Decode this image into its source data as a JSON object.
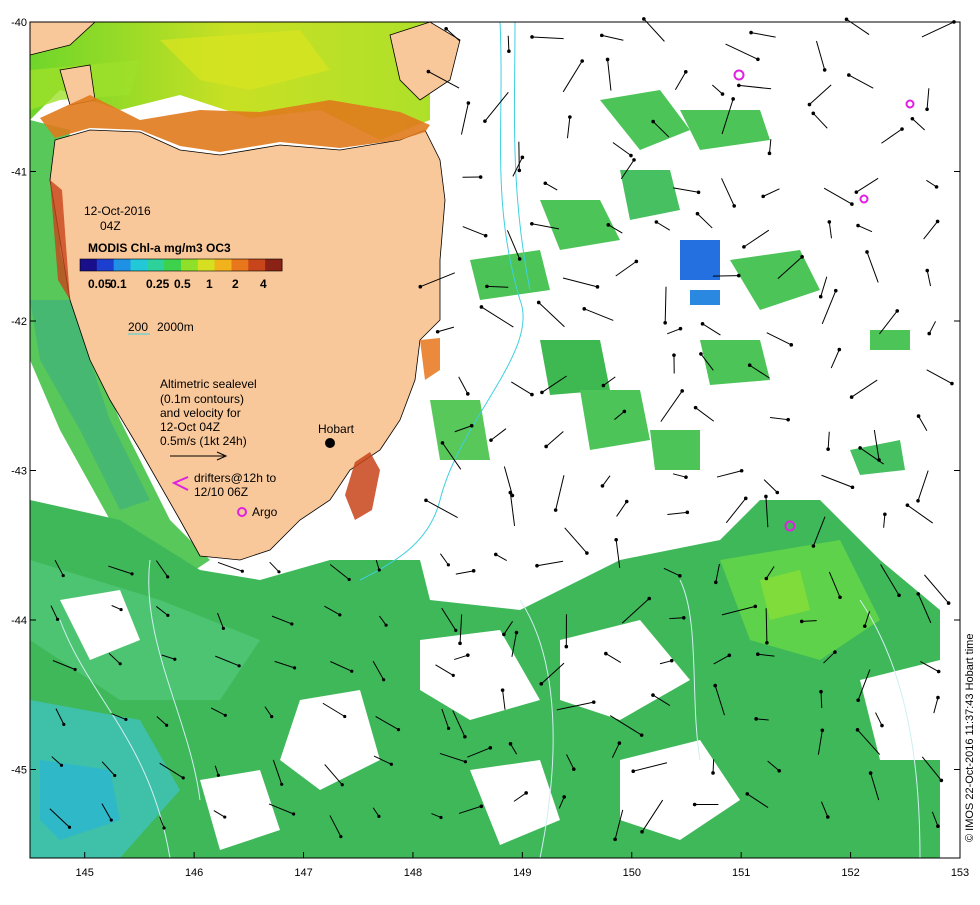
{
  "map": {
    "date_line": "12-Oct-2016",
    "time_line": "04Z",
    "colorbar_title": "MODIS Chl-a mg/m3 OC3",
    "colorbar_ticks": [
      "0.05",
      "0.1",
      "0.25",
      "0.5",
      "1",
      "2",
      "4"
    ],
    "colorbar_colors": [
      "#1a0f8a",
      "#1c3fd0",
      "#1e90e6",
      "#22c8d8",
      "#2cd29a",
      "#3ed24c",
      "#8ee028",
      "#d6e020",
      "#f2b21c",
      "#e8761a",
      "#c8441a",
      "#8a2216"
    ],
    "contour_label_200": "200",
    "contour_label_2000": "2000m",
    "contour_color": "#3fd0e0",
    "sealevel_lines": [
      "Altimetric sealevel",
      "(0.1m contours)",
      "and velocity for",
      "12-Oct 04Z",
      "0.5m/s (1kt 24h)"
    ],
    "drifter_lines": [
      "drifters@12h to",
      "12/10 06Z"
    ],
    "argo_label": "Argo",
    "place_label": "Hobart",
    "credit": "© IMOS 22-Oct-2016 11:37:43 Hobart time",
    "x_ticks": [
      "145",
      "146",
      "147",
      "148",
      "149",
      "150",
      "151",
      "152",
      "153"
    ],
    "y_ticks": [
      "-40",
      "-41",
      "-42",
      "-43",
      "-44",
      "-45"
    ],
    "land_color": "#f9c89a",
    "marker_color": "#e020e0"
  }
}
